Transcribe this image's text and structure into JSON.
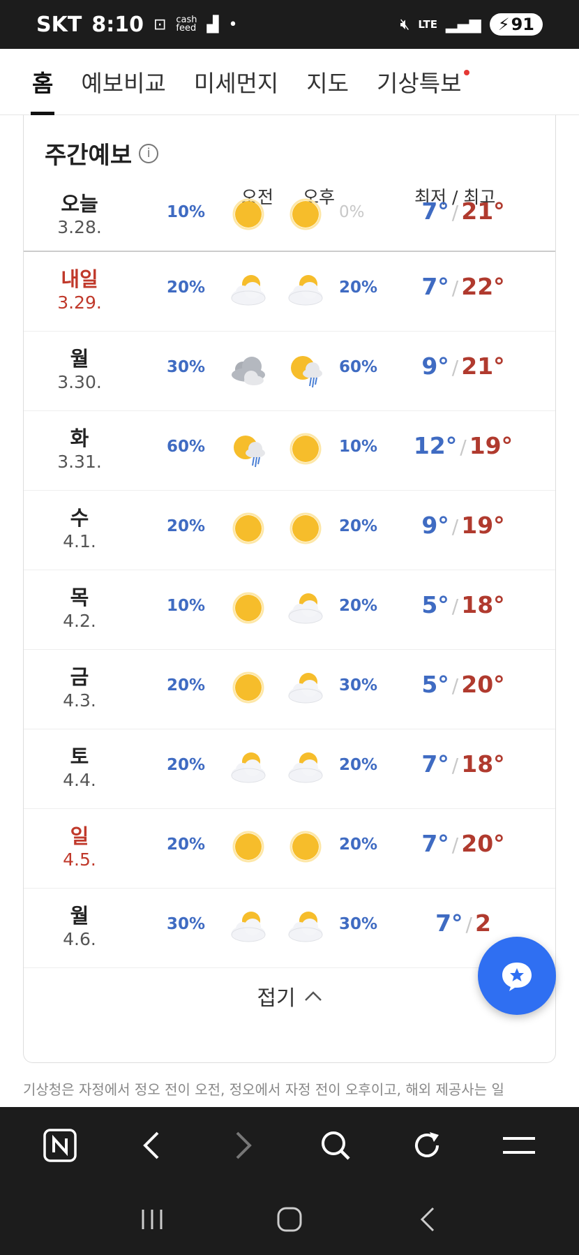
{
  "status": {
    "carrier": "SKT",
    "time": "8:10",
    "network": "LTE",
    "battery": "91"
  },
  "tabs": [
    {
      "label": "홈",
      "active": true
    },
    {
      "label": "예보비교"
    },
    {
      "label": "미세먼지"
    },
    {
      "label": "지도"
    },
    {
      "label": "기상특보",
      "dot": true
    }
  ],
  "weekly": {
    "title": "주간예보",
    "head_am": "오전",
    "head_pm": "오후",
    "head_temp": "최저 / 최고",
    "rows": [
      {
        "day": "오늘",
        "date": "3.28.",
        "am_pct": "10%",
        "am_icon": "sunny",
        "pm_icon": "sunny",
        "pm_pct": "0%",
        "low": "7°",
        "high": "21°",
        "red": false
      },
      {
        "day": "내일",
        "date": "3.29.",
        "am_pct": "20%",
        "am_icon": "partly-cloudy",
        "pm_icon": "partly-cloudy",
        "pm_pct": "20%",
        "low": "7°",
        "high": "22°",
        "red": true
      },
      {
        "day": "월",
        "date": "3.30.",
        "am_pct": "30%",
        "am_icon": "cloudy",
        "pm_icon": "sun-rain",
        "pm_pct": "60%",
        "low": "9°",
        "high": "21°",
        "red": false
      },
      {
        "day": "화",
        "date": "3.31.",
        "am_pct": "60%",
        "am_icon": "sun-rain",
        "pm_icon": "sunny",
        "pm_pct": "10%",
        "low": "12°",
        "high": "19°",
        "red": false
      },
      {
        "day": "수",
        "date": "4.1.",
        "am_pct": "20%",
        "am_icon": "sunny",
        "pm_icon": "sunny",
        "pm_pct": "20%",
        "low": "9°",
        "high": "19°",
        "red": false
      },
      {
        "day": "목",
        "date": "4.2.",
        "am_pct": "10%",
        "am_icon": "sunny",
        "pm_icon": "partly-cloudy",
        "pm_pct": "20%",
        "low": "5°",
        "high": "18°",
        "red": false
      },
      {
        "day": "금",
        "date": "4.3.",
        "am_pct": "20%",
        "am_icon": "sunny",
        "pm_icon": "partly-cloudy",
        "pm_pct": "30%",
        "low": "5°",
        "high": "20°",
        "red": false
      },
      {
        "day": "토",
        "date": "4.4.",
        "am_pct": "20%",
        "am_icon": "partly-cloudy",
        "pm_icon": "partly-cloudy",
        "pm_pct": "20%",
        "low": "7°",
        "high": "18°",
        "red": false
      },
      {
        "day": "일",
        "date": "4.5.",
        "am_pct": "20%",
        "am_icon": "sunny",
        "pm_icon": "sunny",
        "pm_pct": "20%",
        "low": "7°",
        "high": "20°",
        "red": true
      },
      {
        "day": "월",
        "date": "4.6.",
        "am_pct": "30%",
        "am_icon": "partly-cloudy",
        "pm_icon": "partly-cloudy",
        "pm_pct": "30%",
        "low": "7°",
        "high": "2",
        "red": false
      }
    ],
    "fold_label": "접기"
  },
  "note": "기상청은 자정에서 정오 전이 오전, 정오에서 자정 전이 오후이고, 해외 제공사는 일",
  "colors": {
    "accent": "#2f6ff2",
    "low": "#3f6bc2",
    "high": "#b03a2e",
    "holiday": "#c0392b"
  }
}
